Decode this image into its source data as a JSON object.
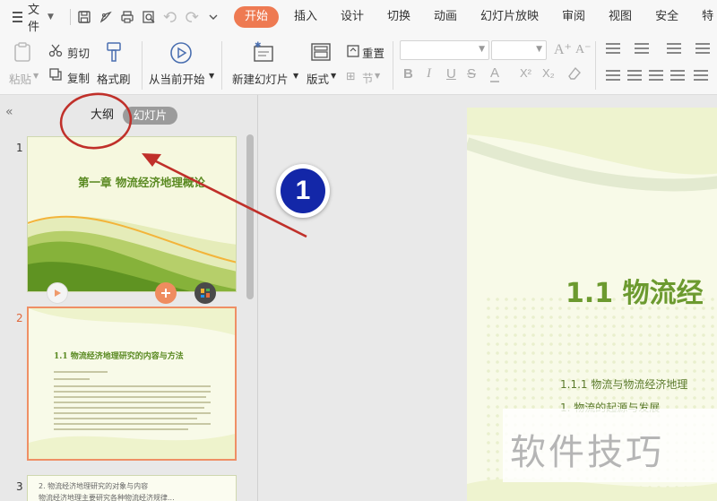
{
  "menubar": {
    "file_label": "文件",
    "tabs": [
      {
        "label": "开始",
        "active": true
      },
      {
        "label": "插入"
      },
      {
        "label": "设计"
      },
      {
        "label": "切换"
      },
      {
        "label": "动画"
      },
      {
        "label": "幻灯片放映"
      },
      {
        "label": "审阅"
      },
      {
        "label": "视图"
      },
      {
        "label": "安全"
      },
      {
        "label": "特"
      }
    ],
    "accent_color": "#ee7a52"
  },
  "ribbon": {
    "paste": "粘贴",
    "cut": "剪切",
    "copy": "复制",
    "format_painter": "格式刷",
    "play_from_current": "从当前开始",
    "new_slide": "新建幻灯片",
    "layout": "版式",
    "reset": "重置",
    "section": "节",
    "format_buttons": [
      "B",
      "I",
      "U",
      "S",
      "A",
      "X²",
      "X₂"
    ],
    "grow_font": "A⁺",
    "shrink_font": "A⁻"
  },
  "left_panel": {
    "outline_tab": "大纲",
    "slides_tab": "幻灯片",
    "slides": [
      {
        "number": "1",
        "title": "第一章  物流经济地理概论"
      },
      {
        "number": "2",
        "title": "1.1  物流经济地理研究的内容与方法"
      },
      {
        "number": "3",
        "line1": "2. 物流经济地理研究的对象与内容",
        "line2": "物流经济地理主要研究各种物流经济规律..."
      }
    ]
  },
  "main_slide": {
    "title": "1.1  物流经",
    "subtitle": "1.1.1 物流与物流经济地理",
    "line2": "1. 物流的起源与发展",
    "watermark": "软件技巧"
  },
  "annotation": {
    "step_number": "1",
    "color": "#c0302a"
  }
}
